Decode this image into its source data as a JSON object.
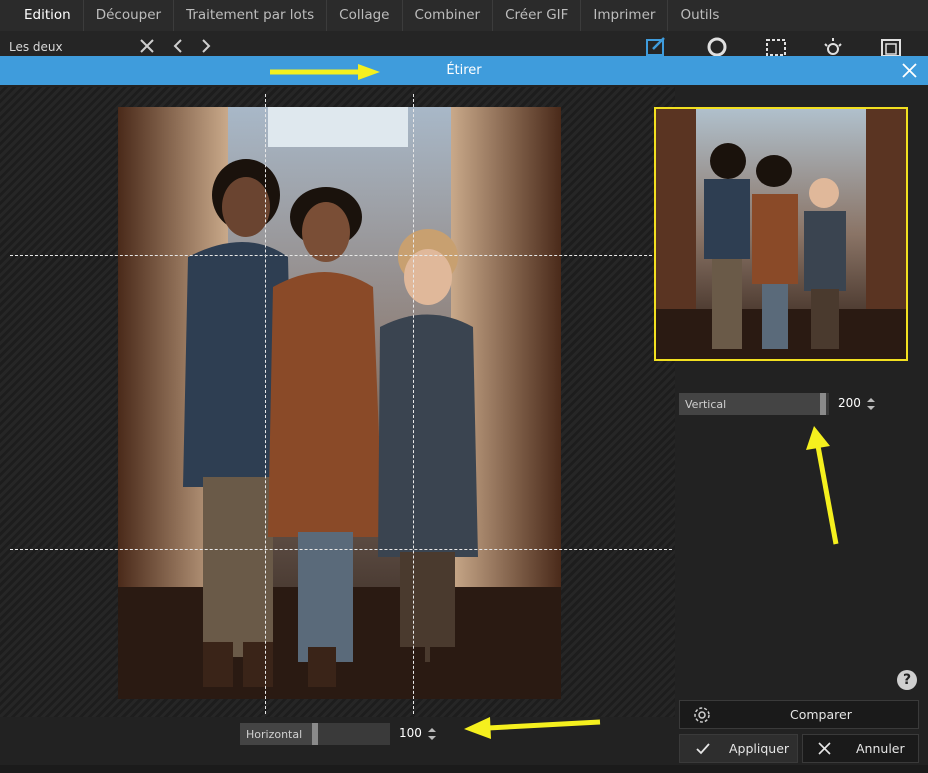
{
  "menu": {
    "items": [
      {
        "label": "Edition",
        "active": true
      },
      {
        "label": "Découper",
        "active": false
      },
      {
        "label": "Traitement par lots",
        "active": false
      },
      {
        "label": "Collage",
        "active": false
      },
      {
        "label": "Combiner",
        "active": false
      },
      {
        "label": "Créer GIF",
        "active": false
      },
      {
        "label": "Imprimer",
        "active": false
      },
      {
        "label": "Outils",
        "active": false
      }
    ]
  },
  "toolbar": {
    "doc_title": "Les deux",
    "icons": [
      "close-icon",
      "undo-icon",
      "redo-icon",
      "edit-icon",
      "search-icon",
      "crop-icon",
      "brightness-icon",
      "frame-icon"
    ]
  },
  "dialog": {
    "title": "Étirer",
    "close_icon": "close-icon"
  },
  "sliders": {
    "vertical": {
      "label": "Vertical",
      "value": "200",
      "fraction": 0.98
    },
    "horizontal": {
      "label": "Horizontal",
      "value": "100",
      "fraction": 0.5
    }
  },
  "buttons": {
    "compare": "Comparer",
    "apply": "Appliquer",
    "cancel": "Annuler",
    "help": "?"
  },
  "colors": {
    "dialog_bar": "#3f9cdc",
    "preview_border": "#f2e020",
    "annotation_arrow": "#f5f01e"
  }
}
